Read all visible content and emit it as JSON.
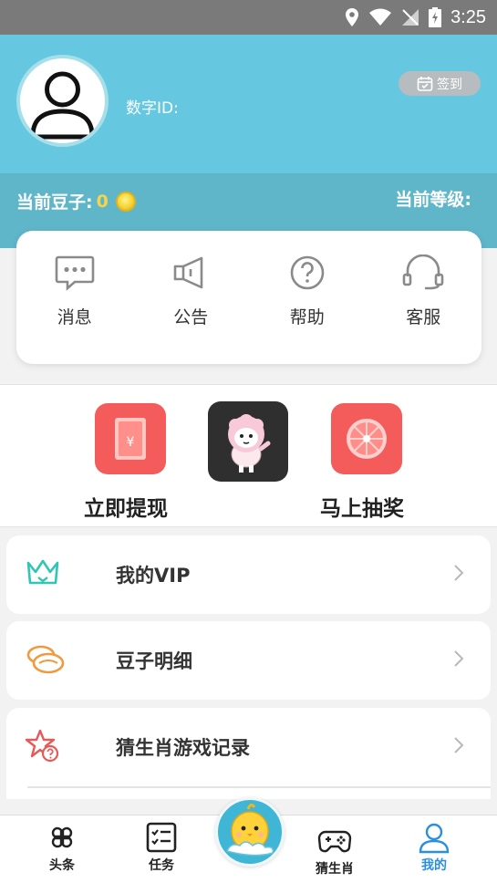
{
  "status_bar": {
    "time": "3:25"
  },
  "profile": {
    "digital_id_label": "数字ID:",
    "signin_label": "签到"
  },
  "beans": {
    "label": "当前豆子:",
    "count": "0",
    "level_label": "当前等级:"
  },
  "quick_actions": [
    {
      "label": "消息",
      "icon": "message-icon"
    },
    {
      "label": "公告",
      "icon": "megaphone-icon"
    },
    {
      "label": "帮助",
      "icon": "help-icon"
    },
    {
      "label": "客服",
      "icon": "headset-icon"
    }
  ],
  "promo": {
    "withdraw_label": "立即提现",
    "lottery_label": "马上抽奖"
  },
  "menu": [
    {
      "label": "我的VIP",
      "icon": "crown-icon"
    },
    {
      "label": "豆子明细",
      "icon": "beans-icon"
    },
    {
      "label": "猜生肖游戏记录",
      "icon": "star-question-icon"
    }
  ],
  "tabbar": [
    {
      "label": "头条",
      "icon": "clover-icon"
    },
    {
      "label": "任务",
      "icon": "checklist-icon"
    },
    {
      "label": "猜生肖",
      "icon": "gamepad-icon"
    },
    {
      "label": "我的",
      "icon": "user-icon",
      "active": true
    }
  ],
  "colors": {
    "header": "#65c8e0",
    "beans_bar": "#5fb6c9",
    "accent_blue": "#2b8fe0",
    "red_tile": "#f25a5a",
    "coin": "#f5d12f"
  }
}
